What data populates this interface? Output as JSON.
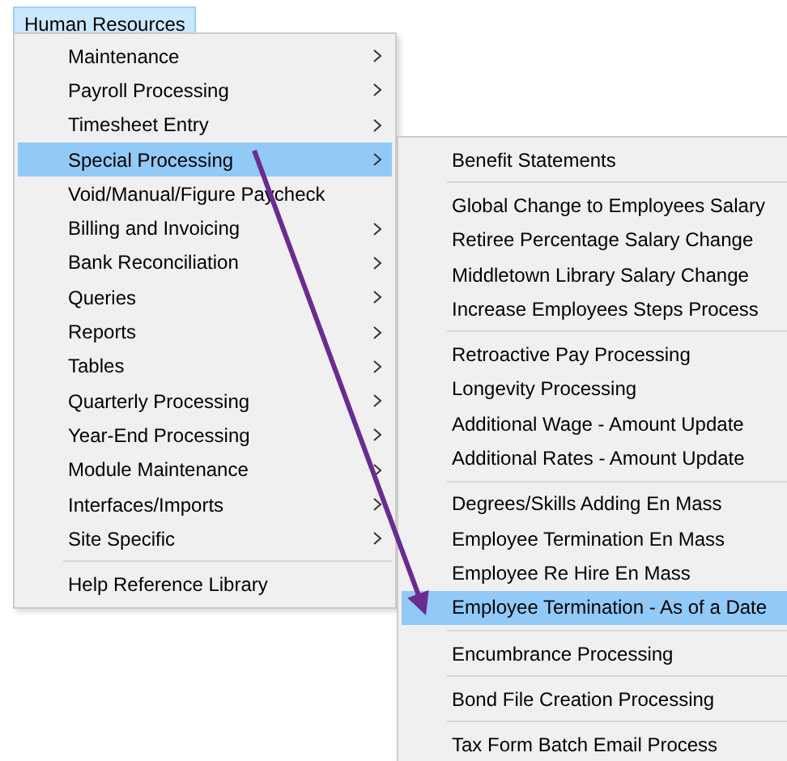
{
  "menubar": [
    {
      "label": "Human Resources",
      "selected": true
    }
  ],
  "menu": [
    {
      "kind": "item",
      "label": "Maintenance",
      "submenu": true,
      "selected": false
    },
    {
      "kind": "item",
      "label": "Payroll Processing",
      "submenu": true,
      "selected": false
    },
    {
      "kind": "item",
      "label": "Timesheet Entry",
      "submenu": true,
      "selected": false
    },
    {
      "kind": "item",
      "label": "Special Processing",
      "submenu": true,
      "selected": true
    },
    {
      "kind": "item",
      "label": "Void/Manual/Figure Paycheck",
      "submenu": false,
      "selected": false
    },
    {
      "kind": "item",
      "label": "Billing and Invoicing",
      "submenu": true,
      "selected": false
    },
    {
      "kind": "item",
      "label": "Bank Reconciliation",
      "submenu": true,
      "selected": false
    },
    {
      "kind": "item",
      "label": "Queries",
      "submenu": true,
      "selected": false
    },
    {
      "kind": "item",
      "label": "Reports",
      "submenu": true,
      "selected": false
    },
    {
      "kind": "item",
      "label": "Tables",
      "submenu": true,
      "selected": false
    },
    {
      "kind": "item",
      "label": "Quarterly Processing",
      "submenu": true,
      "selected": false
    },
    {
      "kind": "item",
      "label": "Year-End Processing",
      "submenu": true,
      "selected": false
    },
    {
      "kind": "item",
      "label": "Module Maintenance",
      "submenu": true,
      "selected": false
    },
    {
      "kind": "item",
      "label": "Interfaces/Imports",
      "submenu": true,
      "selected": false
    },
    {
      "kind": "item",
      "label": "Site Specific",
      "submenu": true,
      "selected": false
    },
    {
      "kind": "separator"
    },
    {
      "kind": "item",
      "label": "Help Reference Library",
      "submenu": false,
      "selected": false
    }
  ],
  "submenu": [
    {
      "kind": "item",
      "label": "Benefit Statements",
      "selected": false
    },
    {
      "kind": "separator"
    },
    {
      "kind": "item",
      "label": "Global Change to Employees Salary",
      "selected": false
    },
    {
      "kind": "item",
      "label": "Retiree Percentage Salary Change",
      "selected": false
    },
    {
      "kind": "item",
      "label": "Middletown Library Salary Change",
      "selected": false
    },
    {
      "kind": "item",
      "label": "Increase Employees Steps Process",
      "selected": false
    },
    {
      "kind": "separator"
    },
    {
      "kind": "item",
      "label": "Retroactive Pay Processing",
      "selected": false
    },
    {
      "kind": "item",
      "label": "Longevity Processing",
      "selected": false
    },
    {
      "kind": "item",
      "label": "Additional Wage - Amount Update",
      "selected": false
    },
    {
      "kind": "item",
      "label": "Additional Rates - Amount Update",
      "selected": false
    },
    {
      "kind": "separator"
    },
    {
      "kind": "item",
      "label": "Degrees/Skills Adding En Mass",
      "selected": false
    },
    {
      "kind": "item",
      "label": "Employee Termination En Mass",
      "selected": false
    },
    {
      "kind": "item",
      "label": "Employee Re Hire En Mass",
      "selected": false
    },
    {
      "kind": "item",
      "label": "Employee Termination - As of a Date",
      "selected": true
    },
    {
      "kind": "separator"
    },
    {
      "kind": "item",
      "label": "Encumbrance Processing",
      "selected": false
    },
    {
      "kind": "separator"
    },
    {
      "kind": "item",
      "label": "Bond File Creation Processing",
      "selected": false
    },
    {
      "kind": "separator"
    },
    {
      "kind": "item",
      "label": "Tax Form Batch Email Process",
      "selected": false
    }
  ]
}
